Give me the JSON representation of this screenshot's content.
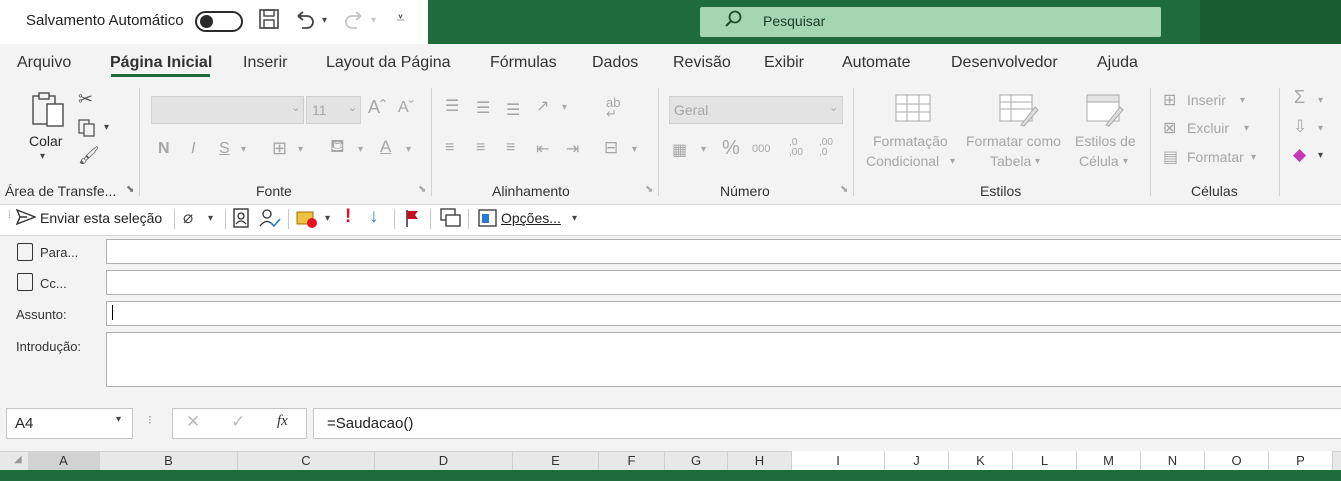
{
  "titlebar": {
    "autosave_label": "Salvamento Automático",
    "search_placeholder": "Pesquisar"
  },
  "tabs": [
    "Arquivo",
    "Página Inicial",
    "Inserir",
    "Layout da Página",
    "Fórmulas",
    "Dados",
    "Revisão",
    "Exibir",
    "Automate",
    "Desenvolvedor",
    "Ajuda"
  ],
  "active_tab": "Página Inicial",
  "ribbon": {
    "clipboard": {
      "paste": "Colar",
      "group": "Área de Transfe..."
    },
    "font": {
      "size": "11",
      "bold": "N",
      "italic": "I",
      "underline": "S",
      "group": "Fonte"
    },
    "alignment": {
      "group": "Alinhamento"
    },
    "number": {
      "format": "Geral",
      "group": "Número",
      "percent": "%",
      "thousands": "000",
      "inc_dec": ",0\n,00",
      "dec_dec": ",00\n,0"
    },
    "styles": {
      "cond_format_1": "Formatação",
      "cond_format_2": "Condicional",
      "table_format_1": "Formatar como",
      "table_format_2": "Tabela",
      "cell_styles_1": "Estilos de",
      "cell_styles_2": "Célula",
      "group": "Estilos"
    },
    "cells": {
      "insert": "Inserir",
      "delete": "Excluir",
      "format": "Formatar",
      "group": "Células"
    }
  },
  "mail_toolbar": {
    "send": "Enviar esta seleção",
    "options": "Opções...",
    "urgent": "!"
  },
  "mail_form": {
    "to_label": "Para...",
    "cc_label": "Cc...",
    "subject_label": "Assunto:",
    "intro_label": "Introdução:"
  },
  "formula_bar": {
    "name_box": "A4",
    "fx": "fx",
    "formula": "=Saudacao()"
  },
  "columns": [
    "A",
    "B",
    "C",
    "D",
    "E",
    "F",
    "G",
    "H",
    "I",
    "J",
    "K",
    "L",
    "M",
    "N",
    "O",
    "P"
  ],
  "selected_column": "A",
  "colors": {
    "accent": "#1e6c3d",
    "search_bg": "#a6d5b4",
    "urgent": "#e81123",
    "low_importance": "#2b7bd3",
    "flag": "#c50f1f"
  }
}
